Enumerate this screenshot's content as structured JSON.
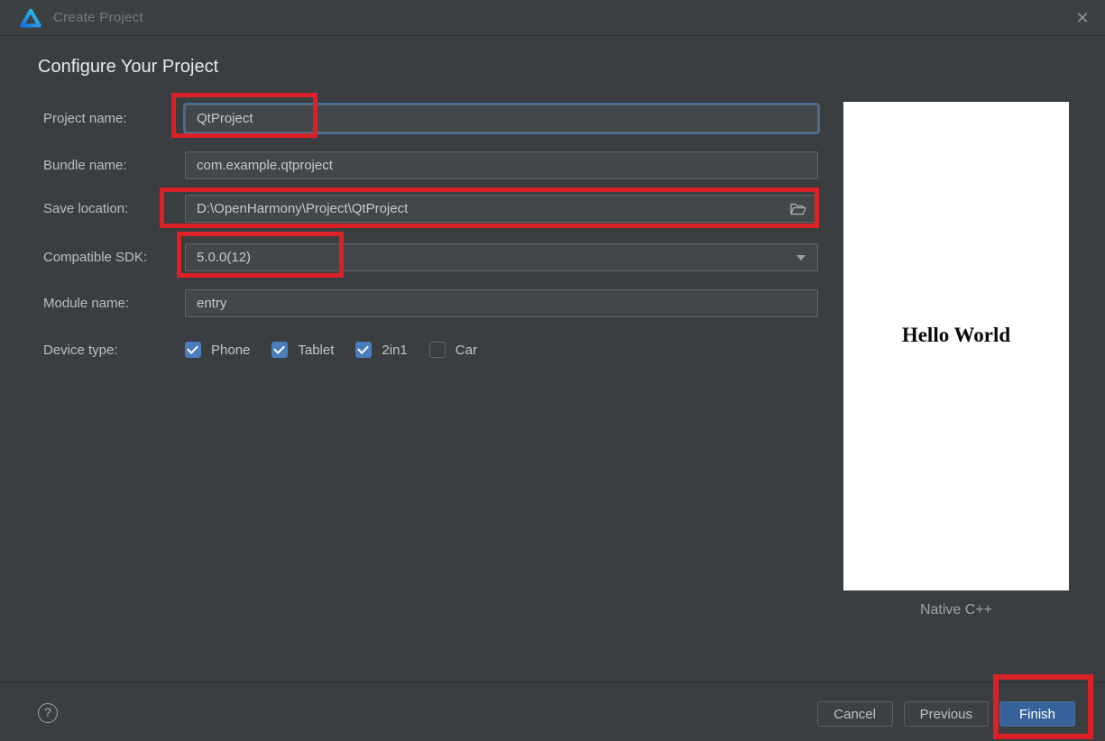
{
  "window": {
    "title": "Create Project"
  },
  "icons": {
    "close": "✕",
    "help": "?"
  },
  "heading": "Configure Your Project",
  "form": {
    "rows": [
      {
        "label": "Project name:",
        "value": "QtProject",
        "focused": true
      },
      {
        "label": "Bundle name:",
        "value": "com.example.qtproject"
      },
      {
        "label": "Save location:",
        "value": "D:\\OpenHarmony\\Project\\QtProject"
      },
      {
        "label": "Compatible SDK:",
        "value": "5.0.0(12)"
      },
      {
        "label": "Module name:",
        "value": "entry"
      }
    ],
    "device_type": {
      "label": "Device type:",
      "options": [
        {
          "label": "Phone",
          "checked": true
        },
        {
          "label": "Tablet",
          "checked": true
        },
        {
          "label": "2in1",
          "checked": true
        },
        {
          "label": "Car",
          "checked": false
        }
      ]
    }
  },
  "preview": {
    "hello_text": "Hello World",
    "template_name": "Native C++"
  },
  "footer": {
    "buttons": [
      {
        "label": "Cancel"
      },
      {
        "label": "Previous"
      },
      {
        "label": "Finish",
        "primary": true
      }
    ]
  },
  "colors": {
    "annotation_red": "#da2127",
    "focus_blue": "#456f9a",
    "checkbox_blue": "#4a7dbe",
    "finish_button_blue": "#36639a"
  }
}
